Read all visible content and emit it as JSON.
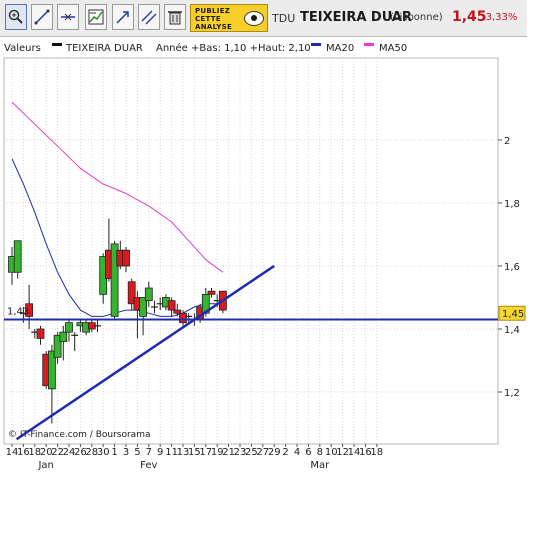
{
  "toolbar": {
    "tools": [
      "zoom-icon",
      "line-icon",
      "horizontal-line-icon",
      "chart-panel-icon",
      "trend-arrow-icon",
      "parallel-lines-icon",
      "trash-icon"
    ],
    "ad_lines": [
      "PUBLIEZ",
      "CETTE",
      "ANALYSE"
    ],
    "ticker": "TDU",
    "name": "TEIXEIRA DUAR",
    "market": "(Lisbonne)",
    "price": "1,45",
    "change": "-3,33%",
    "price_color": "#c0131d"
  },
  "legend": {
    "values_label": "Valeurs",
    "series_name": "TEIXEIRA DUAR",
    "range_text": "Année +Bas: 1,10 +Haut: 2,10",
    "ma20": "MA20",
    "ma50": "MA50",
    "ma20_color": "#1f2bb0",
    "ma50_color": "#e040d0"
  },
  "chart_data": {
    "type": "candlestick",
    "y_ticks": [
      "1,2",
      "1,4",
      "1,6",
      "1,8",
      "2"
    ],
    "y_tick_values": [
      1.2,
      1.4,
      1.6,
      1.8,
      2.0
    ],
    "ylim": [
      1.035,
      2.26
    ],
    "x_tick_labels": [
      "14",
      "16",
      "18",
      "20",
      "22",
      "24",
      "26",
      "28",
      "30",
      "1",
      "3",
      "5",
      "7",
      "9",
      "11",
      "13",
      "15",
      "17",
      "19",
      "21",
      "23",
      "25",
      "27",
      "29",
      "2",
      "4",
      "6",
      "8",
      "10",
      "12",
      "14",
      "16",
      "18"
    ],
    "month_labels": [
      {
        "label": "Jan",
        "slot": 3
      },
      {
        "label": "Fev",
        "slot": 12
      },
      {
        "label": "Mar",
        "slot": 27
      }
    ],
    "candles": [
      {
        "slot": 0,
        "open": 1.58,
        "close": 1.63,
        "high": 1.66,
        "low": 1.54
      },
      {
        "slot": 1,
        "open": 1.58,
        "close": 1.68,
        "high": 1.68,
        "low": 1.56
      },
      {
        "slot": 2,
        "open": 1.45,
        "close": 1.45,
        "high": 1.47,
        "low": 1.42
      },
      {
        "slot": 3,
        "open": 1.48,
        "close": 1.44,
        "high": 1.54,
        "low": 1.4
      },
      {
        "slot": 4,
        "open": 1.39,
        "close": 1.39,
        "high": 1.4,
        "low": 1.37
      },
      {
        "slot": 5,
        "open": 1.4,
        "close": 1.37,
        "high": 1.41,
        "low": 1.35
      },
      {
        "slot": 6,
        "open": 1.32,
        "close": 1.22,
        "high": 1.33,
        "low": 1.21
      },
      {
        "slot": 7,
        "open": 1.21,
        "close": 1.33,
        "high": 1.35,
        "low": 1.1
      },
      {
        "slot": 8,
        "open": 1.31,
        "close": 1.38,
        "high": 1.39,
        "low": 1.29
      },
      {
        "slot": 9,
        "open": 1.36,
        "close": 1.39,
        "high": 1.41,
        "low": 1.3
      },
      {
        "slot": 10,
        "open": 1.39,
        "close": 1.42,
        "high": 1.43,
        "low": 1.36
      },
      {
        "slot": 11,
        "open": 1.38,
        "close": 1.38,
        "high": 1.39,
        "low": 1.33
      },
      {
        "slot": 12,
        "open": 1.41,
        "close": 1.42,
        "high": 1.43,
        "low": 1.39
      },
      {
        "slot": 13,
        "open": 1.39,
        "close": 1.42,
        "high": 1.43,
        "low": 1.38
      },
      {
        "slot": 14,
        "open": 1.42,
        "close": 1.4,
        "high": 1.43,
        "low": 1.39
      },
      {
        "slot": 15,
        "open": 1.41,
        "close": 1.41,
        "high": 1.43,
        "low": 1.39
      },
      {
        "slot": 16,
        "open": 1.51,
        "close": 1.63,
        "high": 1.64,
        "low": 1.48
      },
      {
        "slot": 17,
        "open": 1.65,
        "close": 1.56,
        "high": 1.75,
        "low": 1.55
      },
      {
        "slot": 18,
        "open": 1.44,
        "close": 1.67,
        "high": 1.68,
        "low": 1.43
      },
      {
        "slot": 19,
        "open": 1.65,
        "close": 1.6,
        "high": 1.68,
        "low": 1.59
      },
      {
        "slot": 20,
        "open": 1.65,
        "close": 1.6,
        "high": 1.66,
        "low": 1.58
      },
      {
        "slot": 21,
        "open": 1.55,
        "close": 1.48,
        "high": 1.56,
        "low": 1.46
      },
      {
        "slot": 22,
        "open": 1.5,
        "close": 1.46,
        "high": 1.52,
        "low": 1.37
      },
      {
        "slot": 23,
        "open": 1.44,
        "close": 1.5,
        "high": 1.5,
        "low": 1.38
      },
      {
        "slot": 24,
        "open": 1.49,
        "close": 1.53,
        "high": 1.55,
        "low": 1.47
      },
      {
        "slot": 25,
        "open": 1.47,
        "close": 1.47,
        "high": 1.49,
        "low": 1.45
      },
      {
        "slot": 26,
        "open": 1.48,
        "close": 1.48,
        "high": 1.5,
        "low": 1.46
      },
      {
        "slot": 27,
        "open": 1.47,
        "close": 1.5,
        "high": 1.51,
        "low": 1.46
      },
      {
        "slot": 28,
        "open": 1.49,
        "close": 1.46,
        "high": 1.5,
        "low": 1.44
      },
      {
        "slot": 29,
        "open": 1.46,
        "close": 1.45,
        "high": 1.48,
        "low": 1.44
      },
      {
        "slot": 30,
        "open": 1.45,
        "close": 1.42,
        "high": 1.46,
        "low": 1.41
      },
      {
        "slot": 31,
        "open": 1.44,
        "close": 1.44,
        "high": 1.45,
        "low": 1.42
      },
      {
        "slot": 32,
        "open": 1.43,
        "close": 1.43,
        "high": 1.45,
        "low": 1.41
      },
      {
        "slot": 33,
        "open": 1.47,
        "close": 1.43,
        "high": 1.48,
        "low": 1.42
      },
      {
        "slot": 34,
        "open": 1.45,
        "close": 1.51,
        "high": 1.53,
        "low": 1.44
      },
      {
        "slot": 35,
        "open": 1.52,
        "close": 1.51,
        "high": 1.53,
        "low": 1.5
      },
      {
        "slot": 36,
        "open": 1.49,
        "close": 1.49,
        "high": 1.51,
        "low": 1.47
      },
      {
        "slot": 37,
        "open": 1.52,
        "close": 1.46,
        "high": 1.52,
        "low": 1.45
      }
    ],
    "ma20": [
      [
        0,
        1.94
      ],
      [
        2,
        1.86
      ],
      [
        4,
        1.77
      ],
      [
        6,
        1.67
      ],
      [
        8,
        1.58
      ],
      [
        10,
        1.51
      ],
      [
        12,
        1.46
      ],
      [
        14,
        1.44
      ],
      [
        16,
        1.44
      ],
      [
        18,
        1.45
      ],
      [
        20,
        1.46
      ],
      [
        22,
        1.46
      ],
      [
        24,
        1.45
      ],
      [
        26,
        1.44
      ],
      [
        28,
        1.44
      ],
      [
        30,
        1.45
      ],
      [
        32,
        1.47
      ],
      [
        34,
        1.48
      ],
      [
        36,
        1.48
      ]
    ],
    "ma50": [
      [
        0,
        2.12
      ],
      [
        4,
        2.05
      ],
      [
        8,
        1.98
      ],
      [
        12,
        1.91
      ],
      [
        16,
        1.86
      ],
      [
        20,
        1.83
      ],
      [
        24,
        1.79
      ],
      [
        28,
        1.74
      ],
      [
        32,
        1.66
      ],
      [
        34,
        1.62
      ],
      [
        37,
        1.58
      ]
    ],
    "support_level": {
      "label": "1,43",
      "value": 1.43
    },
    "trendline": {
      "from": [
        0.8,
        1.05
      ],
      "to": [
        46,
        1.6
      ]
    },
    "last_price_label": "1,45",
    "last_price": 1.45,
    "up_color": "#35b52f",
    "down_color": "#d81b20",
    "line_color": "#1f2bb0",
    "grid": true,
    "copyright": "© IT-Finance.com / Boursorama"
  }
}
